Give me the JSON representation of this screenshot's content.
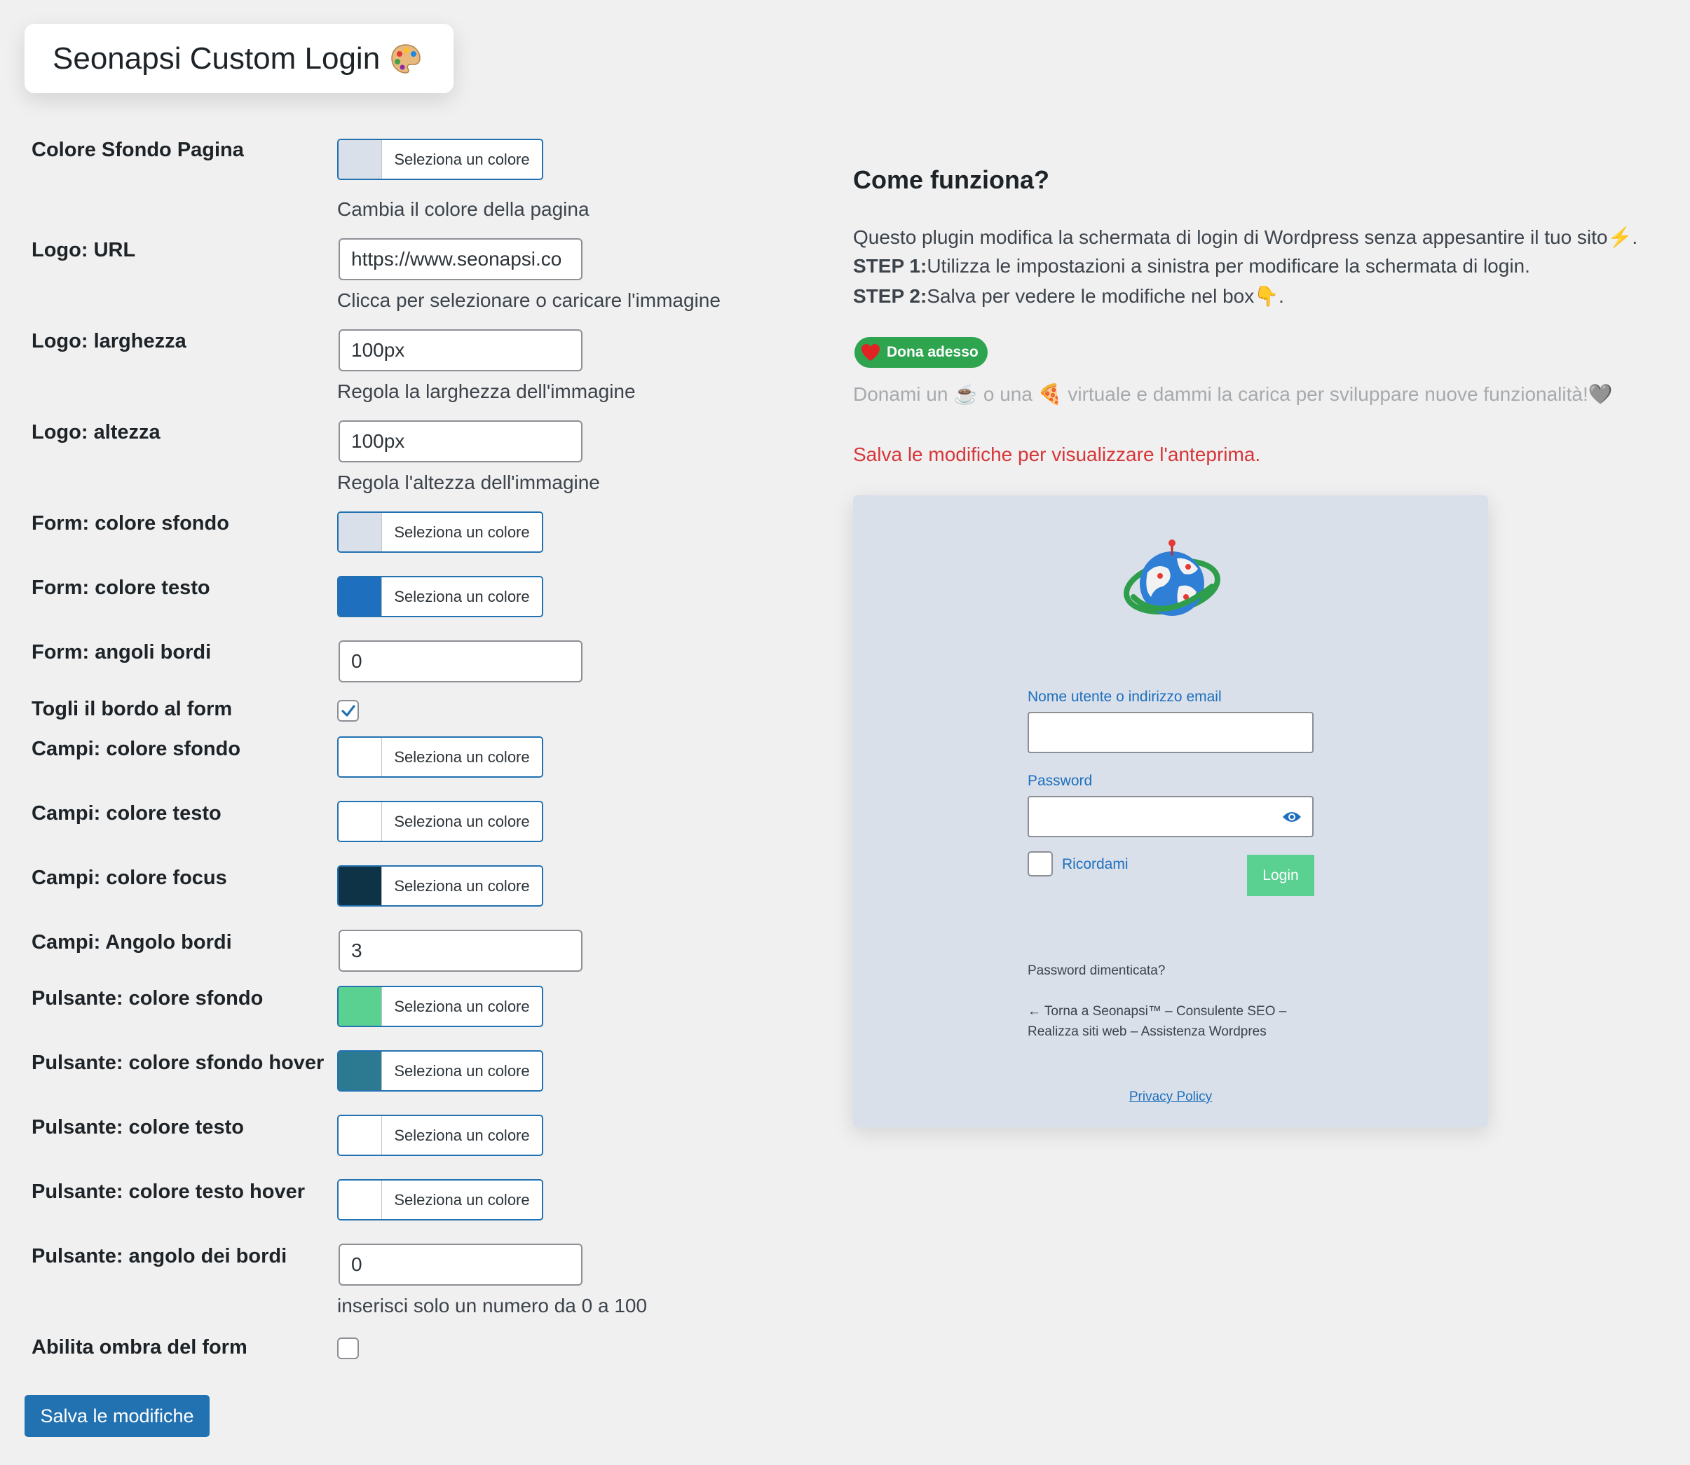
{
  "header": {
    "title": "Seonapsi Custom Login",
    "title_emoji_icon": "palette-icon"
  },
  "settings": [
    {
      "label": "Colore Sfondo Pagina",
      "type": "color",
      "color": "#d9e0ea",
      "button_label": "Seleziona un colore",
      "description": "Cambia il colore della pagina"
    },
    {
      "label": "Logo: URL",
      "type": "text",
      "value": "https://www.seonapsi.co",
      "description": "Clicca per selezionare o caricare l'immagine"
    },
    {
      "label": "Logo: larghezza",
      "type": "text",
      "value": "100px",
      "description": "Regola la larghezza dell'immagine"
    },
    {
      "label": "Logo: altezza",
      "type": "text",
      "value": "100px",
      "description": "Regola l'altezza dell'immagine"
    },
    {
      "label": "Form: colore sfondo",
      "type": "color",
      "color": "#d9e0ea",
      "button_label": "Seleziona un colore"
    },
    {
      "label": "Form: colore testo",
      "type": "color",
      "color": "#1e6fbd",
      "button_label": "Seleziona un colore"
    },
    {
      "label": "Form: angoli bordi",
      "type": "text",
      "value": "0"
    },
    {
      "label": "Togli il bordo al form",
      "type": "checkbox",
      "checked": true
    },
    {
      "label": "Campi: colore sfondo",
      "type": "color",
      "color": "#ffffff",
      "button_label": "Seleziona un colore"
    },
    {
      "label": "Campi: colore testo",
      "type": "color",
      "color": "#ffffff",
      "button_label": "Seleziona un colore"
    },
    {
      "label": "Campi: colore focus",
      "type": "color",
      "color": "#0e3346",
      "button_label": "Seleziona un colore"
    },
    {
      "label": "Campi: Angolo bordi",
      "type": "text",
      "value": "3"
    },
    {
      "label": "Pulsante: colore sfondo",
      "type": "color",
      "color": "#5bd191",
      "button_label": "Seleziona un colore"
    },
    {
      "label": "Pulsante: colore sfondo hover",
      "type": "color",
      "color": "#2c7a92",
      "button_label": "Seleziona un colore"
    },
    {
      "label": "Pulsante: colore testo",
      "type": "color",
      "color": "#ffffff",
      "button_label": "Seleziona un colore"
    },
    {
      "label": "Pulsante: colore testo hover",
      "type": "color",
      "color": "#ffffff",
      "button_label": "Seleziona un colore"
    },
    {
      "label": "Pulsante: angolo dei bordi",
      "type": "text",
      "value": "0",
      "description": "inserisci solo un numero da 0 a 100"
    },
    {
      "label": "Abilita ombra del form",
      "type": "checkbox",
      "checked": false
    }
  ],
  "save_button": "Salva le modifiche",
  "info": {
    "title": "Come funziona?",
    "line1": "Questo plugin modifica la schermata di login di Wordpress senza appesantire il tuo sito",
    "line1_emoji": "⚡",
    "line1_end": ".",
    "step1_label": "STEP 1:",
    "step1_text": "Utilizza le impostazioni a sinistra per modificare la schermata di login.",
    "step2_label": "STEP 2:",
    "step2_text": "Salva per vedere le modifiche nel box",
    "step2_emoji": "👇",
    "step2_end": ".",
    "donate_button": "Dona adesso",
    "donate_icon": "heart-icon",
    "donate_text_a": "Donami un",
    "donate_emoji_a": "☕",
    "donate_text_b": "o una",
    "donate_emoji_b": "🍕",
    "donate_text_c": "virtuale e dammi la carica per sviluppare nuove funzionalità!",
    "donate_emoji_c": "🩶",
    "save_note": "Salva le modifiche per visualizzare l'anteprima."
  },
  "preview": {
    "background": "#d9e0ea",
    "logo_icon": "globe-logo-icon",
    "username_label": "Nome utente o indirizzo email",
    "password_label": "Password",
    "remember_label": "Ricordami",
    "login_button": "Login",
    "lost_password": "Password dimenticata?",
    "back_link": "← Torna a Seonapsi™ – Consulente SEO – Realizza siti web – Assistenza Wordpres",
    "privacy_policy": "Privacy Policy"
  }
}
